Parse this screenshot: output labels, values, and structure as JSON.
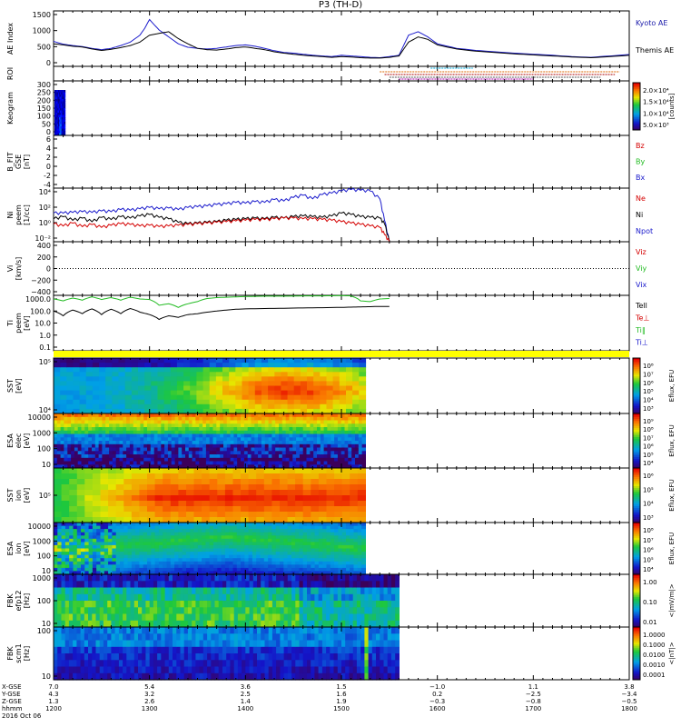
{
  "title": "P3 (TH-D)",
  "colors": {
    "kyoto": "#1a1aaa",
    "themis": "#000000",
    "red": "#d40000",
    "green": "#22bb22",
    "blue": "#1a1acc",
    "bar_yellow": "#ffff00"
  },
  "chart_data": [
    {
      "type": "line",
      "panel": "ae",
      "ylabel": "AE Index",
      "ylim": [
        0,
        1600
      ],
      "yticks": [
        "1500",
        "1000",
        "500",
        "0"
      ],
      "legend": [
        "Kyoto AE",
        "Themis AE"
      ],
      "x": [
        1200,
        1210,
        1220,
        1230,
        1240,
        1250,
        1260,
        1270,
        1280,
        1290,
        1295,
        1300,
        1310,
        1320,
        1330,
        1340,
        1350,
        1360,
        1370,
        1380,
        1390,
        1400,
        1410,
        1420,
        1430,
        1440,
        1450,
        1460,
        1470,
        1480,
        1490,
        1500,
        1510,
        1520,
        1530,
        1540,
        1550,
        1560,
        1570,
        1580,
        1590,
        1600,
        1620,
        1640,
        1660,
        1680,
        1700,
        1720,
        1740,
        1760,
        1780,
        1800
      ],
      "series": [
        {
          "name": "Kyoto AE",
          "color": "blue",
          "values": [
            720,
            640,
            600,
            570,
            520,
            480,
            520,
            600,
            700,
            900,
            1100,
            1350,
            1050,
            850,
            650,
            550,
            520,
            500,
            520,
            560,
            600,
            620,
            580,
            520,
            450,
            400,
            380,
            350,
            320,
            300,
            280,
            320,
            300,
            280,
            260,
            250,
            280,
            320,
            900,
            1000,
            850,
            650,
            520,
            460,
            420,
            380,
            350,
            320,
            280,
            260,
            300,
            340
          ]
        },
        {
          "name": "Themis AE",
          "color": "themis",
          "values": [
            650,
            620,
            580,
            560,
            500,
            460,
            490,
            540,
            600,
            700,
            800,
            900,
            950,
            1000,
            800,
            650,
            520,
            480,
            470,
            500,
            540,
            560,
            520,
            480,
            420,
            380,
            350,
            320,
            300,
            280,
            260,
            280,
            270,
            250,
            240,
            240,
            260,
            300,
            700,
            850,
            780,
            620,
            500,
            440,
            400,
            360,
            330,
            300,
            270,
            250,
            280,
            320
          ]
        }
      ]
    },
    {
      "type": "table",
      "panel": "roi",
      "ylabel": "ROI"
    },
    {
      "type": "heatmap",
      "panel": "keogram",
      "ylabel": "Keogram",
      "ylim": [
        0,
        300
      ],
      "yticks": [
        "300",
        "250",
        "200",
        "150",
        "100",
        "50",
        "0"
      ],
      "colorbar_ticks": [
        "2.0×10⁴",
        "1.5×10⁴",
        "1.0×10⁴",
        "5.0×10³"
      ],
      "colorbar_label": "[counts]"
    },
    {
      "type": "line",
      "panel": "bfield",
      "ylabel": "B_FIT\nGSE\n[nT]",
      "ylim": [
        -4,
        6
      ],
      "yticks": [
        "6",
        "4",
        "2",
        "0",
        "-2",
        "-4"
      ],
      "legend": [
        "Bz",
        "By",
        "Bx"
      ]
    },
    {
      "type": "line",
      "panel": "density",
      "ylabel": "Ni\npeem\n[1/cc]",
      "yticks": [
        "10⁴",
        "10²",
        "10⁰",
        "10⁻²"
      ],
      "legend": [
        "Ne",
        "Ni",
        "Npot"
      ],
      "x": [
        1200,
        1210,
        1220,
        1230,
        1240,
        1250,
        1260,
        1270,
        1280,
        1290,
        1300,
        1310,
        1320,
        1330,
        1340,
        1350,
        1360,
        1370,
        1380,
        1390,
        1400,
        1410,
        1420,
        1430,
        1440,
        1450,
        1460,
        1470,
        1480,
        1490,
        1500,
        1510,
        1520,
        1530,
        1540,
        1545,
        1550
      ],
      "series": [
        {
          "name": "Npot",
          "color": "blue",
          "values": [
            1.0,
            1.0,
            1.1,
            1.2,
            1.1,
            1.3,
            1.2,
            1.5,
            1.4,
            1.6,
            1.8,
            1.6,
            1.7,
            1.5,
            1.8,
            1.9,
            2.0,
            2.2,
            2.3,
            2.5,
            2.4,
            2.6,
            2.5,
            2.9,
            2.7,
            3.2,
            3.5,
            3.0,
            3.6,
            3.8,
            4.1,
            4.3,
            4.2,
            4.1,
            3.0,
            0.0,
            -3.0
          ]
        },
        {
          "name": "Ni",
          "color": "themis",
          "values": [
            0.2,
            0.5,
            0.0,
            0.3,
            -0.2,
            0.4,
            0.1,
            0.5,
            0.3,
            0.6,
            0.8,
            0.4,
            0.2,
            -0.3,
            -0.5,
            -0.4,
            -0.3,
            -0.2,
            0.0,
            0.1,
            0.2,
            0.3,
            0.2,
            0.4,
            0.3,
            0.5,
            0.6,
            0.5,
            0.4,
            0.6,
            1.0,
            0.8,
            0.5,
            0.4,
            0.3,
            -0.5,
            -3.0
          ]
        },
        {
          "name": "Ne",
          "color": "red",
          "values": [
            -0.5,
            -0.8,
            -0.4,
            -0.9,
            -0.6,
            -1.0,
            -0.7,
            -0.5,
            -0.6,
            -0.8,
            -0.7,
            -0.9,
            -0.8,
            -0.7,
            -0.6,
            -0.5,
            -0.4,
            -0.3,
            -0.2,
            -0.1,
            0.0,
            0.1,
            0.1,
            0.2,
            0.3,
            0.3,
            0.2,
            0.2,
            0.1,
            0.0,
            -0.2,
            -0.4,
            -0.6,
            -0.8,
            -1.0,
            -2.0,
            -3.0
          ]
        }
      ]
    },
    {
      "type": "line",
      "panel": "velocity",
      "ylabel": "Vi\n[km/s]",
      "ylim": [
        -400,
        400
      ],
      "yticks": [
        "400",
        "200",
        "0",
        "−200",
        "−400"
      ],
      "legend": [
        "Viz",
        "Viy",
        "Vix"
      ]
    },
    {
      "type": "line",
      "panel": "temperature",
      "ylabel": "Ti\npeem\n[eV]",
      "yticks": [
        "1000.0",
        "100.0",
        "10.0",
        "1.0",
        "0.1"
      ],
      "legend": [
        "Tell",
        "Te⊥",
        "Ti‖",
        "Ti⊥"
      ],
      "x": [
        1200,
        1210,
        1220,
        1230,
        1240,
        1250,
        1260,
        1270,
        1280,
        1290,
        1300,
        1310,
        1320,
        1330,
        1340,
        1350,
        1360,
        1370,
        1380,
        1390,
        1400,
        1420,
        1440,
        1460,
        1480,
        1500,
        1510,
        1520,
        1530,
        1540,
        1550
      ],
      "series": [
        {
          "name": "Ti‖",
          "color": "green",
          "values": [
            1000,
            700,
            1200,
            800,
            1500,
            900,
            1300,
            800,
            1400,
            1000,
            900,
            300,
            400,
            200,
            400,
            600,
            1100,
            1300,
            1400,
            1500,
            1600,
            1700,
            1700,
            1800,
            1800,
            1900,
            1800,
            700,
            600,
            1000,
            1100
          ]
        },
        {
          "name": "Tell",
          "color": "themis",
          "values": [
            100,
            40,
            120,
            60,
            150,
            50,
            140,
            60,
            160,
            80,
            50,
            20,
            40,
            30,
            50,
            60,
            80,
            100,
            120,
            140,
            150,
            160,
            170,
            180,
            190,
            200,
            210,
            220,
            230,
            240,
            240
          ]
        }
      ]
    },
    {
      "type": "heatmap",
      "panel": "sst_e",
      "ylabel": "SST\n[eV]",
      "yticks": [
        "10⁵",
        "10⁴"
      ],
      "colorbar_ticks": [
        "10⁸",
        "10⁷",
        "10⁶",
        "10⁵",
        "10⁴",
        "10³"
      ],
      "colorbar_label": "Eflux, EFU"
    },
    {
      "type": "heatmap",
      "panel": "esa_e",
      "ylabel": "ESA\nelec\n[eV]",
      "yticks": [
        "10000",
        "1000",
        "100",
        "10"
      ],
      "colorbar_ticks": [
        "10⁹",
        "10⁸",
        "10⁷",
        "10⁶",
        "10⁵",
        "10⁴"
      ],
      "colorbar_label": "Eflux, EFU"
    },
    {
      "type": "heatmap",
      "panel": "sst_i",
      "ylabel": "SST\nion\n[eV]",
      "yticks": [
        "10⁵"
      ],
      "colorbar_ticks": [
        "10⁶",
        "10⁵",
        "10⁴",
        "10³"
      ],
      "colorbar_label": "Eflux, EFU"
    },
    {
      "type": "heatmap",
      "panel": "esa_i",
      "ylabel": "ESA\nion\n[eV]",
      "yticks": [
        "10000",
        "1000",
        "100",
        "10"
      ],
      "colorbar_ticks": [
        "10⁸",
        "10⁷",
        "10⁶",
        "10⁵",
        "10⁴"
      ],
      "colorbar_label": "Eflux, EFU"
    },
    {
      "type": "heatmap",
      "panel": "fbk_e",
      "ylabel": "FBK\nefp12\n[Hz]",
      "yticks": [
        "1000",
        "100",
        "10"
      ],
      "colorbar_ticks": [
        "1.00",
        "0.10",
        "0.01"
      ],
      "colorbar_label": "<|mV/m|>"
    },
    {
      "type": "heatmap",
      "panel": "fbk_b",
      "ylabel": "FBK\nscm1\n[Hz]",
      "yticks": [
        "100",
        "10"
      ],
      "colorbar_ticks": [
        "1.0000",
        "0.1000",
        "0.0100",
        "0.0010",
        "0.0001"
      ],
      "colorbar_label": "<|nT|>"
    }
  ],
  "time_axis": {
    "row_labels": [
      "X-GSE",
      "Y-GSE",
      "Z-GSE",
      "hhmm",
      "2016 Oct 06"
    ],
    "columns": [
      {
        "hhmm": "1200",
        "values": [
          "7.0",
          "4.3",
          "1.3"
        ]
      },
      {
        "hhmm": "1300",
        "values": [
          "5.4",
          "3.2",
          "2.6"
        ]
      },
      {
        "hhmm": "1400",
        "values": [
          "3.6",
          "2.5",
          "1.4"
        ]
      },
      {
        "hhmm": "1500",
        "values": [
          "1.5",
          "1.6",
          "1.9"
        ]
      },
      {
        "hhmm": "1600",
        "values": [
          "−1.0",
          "0.2",
          "−0.3"
        ]
      },
      {
        "hhmm": "1700",
        "values": [
          "1.1",
          "−2.5",
          "−0.8"
        ]
      },
      {
        "hhmm": "1800",
        "values": [
          "3.8",
          "−3.4",
          "−0.5"
        ]
      }
    ]
  }
}
